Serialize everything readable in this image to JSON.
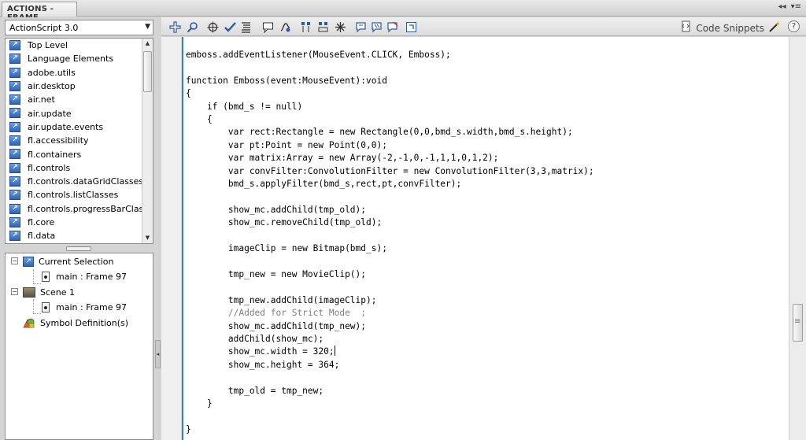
{
  "window": {
    "title": "ACTIONS - FRAME",
    "controls": [
      "◂◂",
      "▾≡"
    ]
  },
  "sidebar": {
    "language_select": {
      "value": "ActionScript 3.0"
    },
    "packages": [
      "Top Level",
      "Language Elements",
      "adobe.utils",
      "air.desktop",
      "air.net",
      "air.update",
      "air.update.events",
      "fl.accessibility",
      "fl.containers",
      "fl.controls",
      "fl.controls.dataGridClasses",
      "fl.controls.listClasses",
      "fl.controls.progressBarClasses",
      "fl.core",
      "fl.data"
    ],
    "tree": {
      "current_selection": "Current Selection",
      "current_frame": "main : Frame 97",
      "scene": "Scene 1",
      "scene_frame": "main : Frame 97",
      "symbol_definitions": "Symbol Definition(s)"
    }
  },
  "toolbar": {
    "code_snippets_label": "Code Snippets",
    "help_label": "?"
  },
  "editor": {
    "lines": [
      "emboss.addEventListener(MouseEvent.CLICK, Emboss);",
      "",
      "function Emboss(event:MouseEvent):void",
      "{",
      "    if (bmd_s != null)",
      "    {",
      "        var rect:Rectangle = new Rectangle(0,0,bmd_s.width,bmd_s.height);",
      "        var pt:Point = new Point(0,0);",
      "        var matrix:Array = new Array(-2,-1,0,-1,1,1,0,1,2);",
      "        var convFilter:ConvolutionFilter = new ConvolutionFilter(3,3,matrix);",
      "        bmd_s.applyFilter(bmd_s,rect,pt,convFilter);",
      "",
      "        show_mc.addChild(tmp_old);",
      "        show_mc.removeChild(tmp_old);",
      "",
      "        imageClip = new Bitmap(bmd_s);",
      "",
      "        tmp_new = new MovieClip();",
      "",
      "        tmp_new.addChild(imageClip);",
      "        //Added for Strict Mode  ;",
      "        show_mc.addChild(tmp_new);",
      "        addChild(show_mc);",
      "        show_mc.width = 320;",
      "        show_mc.height = 364;",
      "",
      "        tmp_old = tmp_new;",
      "    }",
      "",
      "}"
    ]
  }
}
